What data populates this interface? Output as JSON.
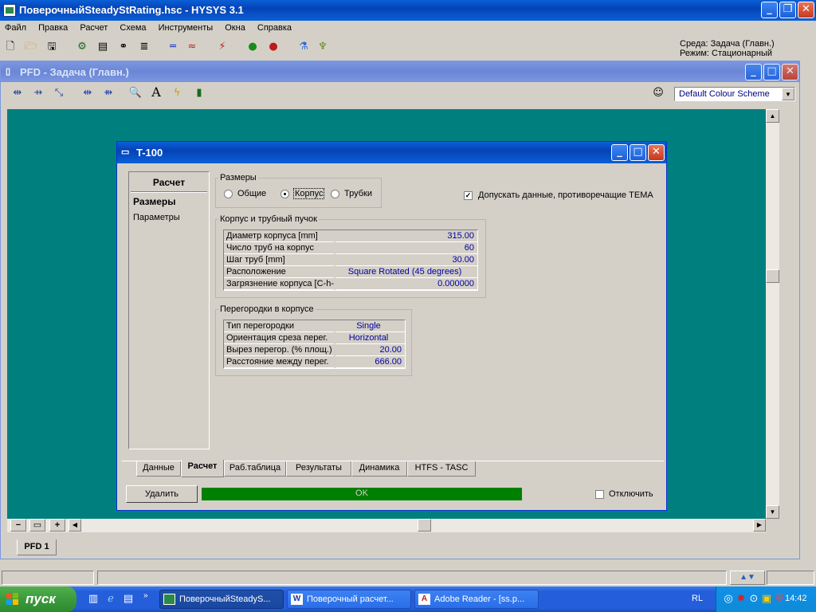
{
  "app": {
    "title": "ПоверочныйSteadyStRating.hsc - HYSYS 3.1",
    "menu": [
      "Файл",
      "Правка",
      "Расчет",
      "Схема",
      "Инструменты",
      "Окна",
      "Справка"
    ],
    "env_line1": "Среда: Задача (Главн.)",
    "env_line2": "Режим: Стационарный"
  },
  "pfd": {
    "title": "PFD - Задача (Главн.)",
    "colour_scheme": "Default Colour Scheme",
    "tab": "PFD 1"
  },
  "dialog": {
    "title": "T-100",
    "nav_header": "Расчет",
    "nav_items": [
      "Размеры",
      "Параметры"
    ],
    "sizes_group": "Размеры",
    "radio_options": [
      "Общие",
      "Корпус",
      "Трубки"
    ],
    "radio_selected": "Корпус",
    "tema_checkbox_label": "Допускать данные, противоречащие TEMA",
    "tema_checked": true,
    "shell_group": "Корпус и трубный пучок",
    "shell_rows": [
      {
        "label": "Диаметр корпуса [mm]",
        "value": "315.00"
      },
      {
        "label": "Число труб на корпус",
        "value": "60"
      },
      {
        "label": "Шаг труб [mm]",
        "value": "30.00"
      },
      {
        "label": "Расположение",
        "value": "Square Rotated (45 degrees)"
      },
      {
        "label": "Загрязнение корпуса [C-h-",
        "value": "0.000000"
      }
    ],
    "baffle_group": "Перегородки в корпусе",
    "baffle_rows": [
      {
        "label": "Тип перегородки",
        "value": "Single"
      },
      {
        "label": "Ориентация среза перег.",
        "value": "Horizontal"
      },
      {
        "label": "Вырез перегор. (% площ.)",
        "value": "20.00"
      },
      {
        "label": "Расстояние между перег.",
        "value": "666.00"
      }
    ],
    "tabs": [
      "Данные",
      "Расчет",
      "Раб.таблица",
      "Результаты",
      "Динамика",
      "HTFS - TASC"
    ],
    "active_tab": "Расчет",
    "delete_button": "Удалить",
    "status": "OK",
    "disable_label": "Отключить"
  },
  "taskbar": {
    "start": "пуск",
    "buttons": [
      "ПоверочныйSteadyS...",
      "Поверочный расчет...",
      "Adobe Reader - [ss.p..."
    ],
    "lang": "RL",
    "time": "14:42"
  },
  "colors": {
    "pfd_background": "#007f7f",
    "status_ok": "#008000",
    "taskbar": "#245edb",
    "start_button": "#3c9a3c"
  }
}
